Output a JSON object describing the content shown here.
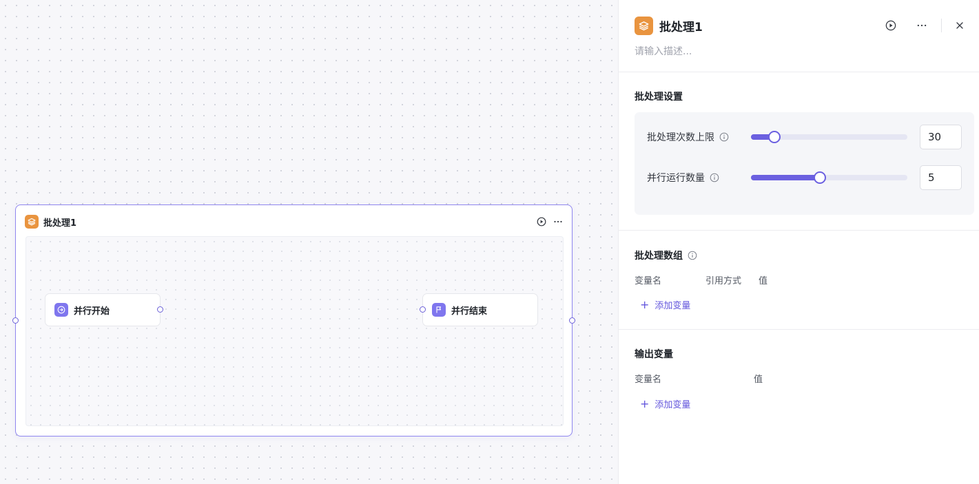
{
  "canvas": {
    "batch_node": {
      "title": "批处理1",
      "start_node": {
        "label": "并行开始",
        "icon": "arrow-right-circle-icon"
      },
      "end_node": {
        "label": "并行结束",
        "icon": "flag-icon"
      },
      "actions": [
        "run-icon",
        "more-icon"
      ]
    }
  },
  "panel": {
    "title": "批处理1",
    "description_placeholder": "请输入描述...",
    "batch_settings": {
      "title": "批处理设置",
      "max_count": {
        "label": "批处理次数上限",
        "value": "30",
        "slider_fraction": 0.15
      },
      "parallel_count": {
        "label": "并行运行数量",
        "value": "5",
        "slider_fraction": 0.44
      }
    },
    "batch_array": {
      "title": "批处理数组",
      "columns": [
        "变量名",
        "引用方式",
        "值"
      ],
      "add_label": "添加变量"
    },
    "output_vars": {
      "title": "输出变量",
      "columns": [
        "变量名",
        "值"
      ],
      "add_label": "添加变量"
    }
  },
  "colors": {
    "accent": "#6b60e0",
    "node_icon": "#e9943f",
    "sub_icon": "#7f76ee"
  }
}
